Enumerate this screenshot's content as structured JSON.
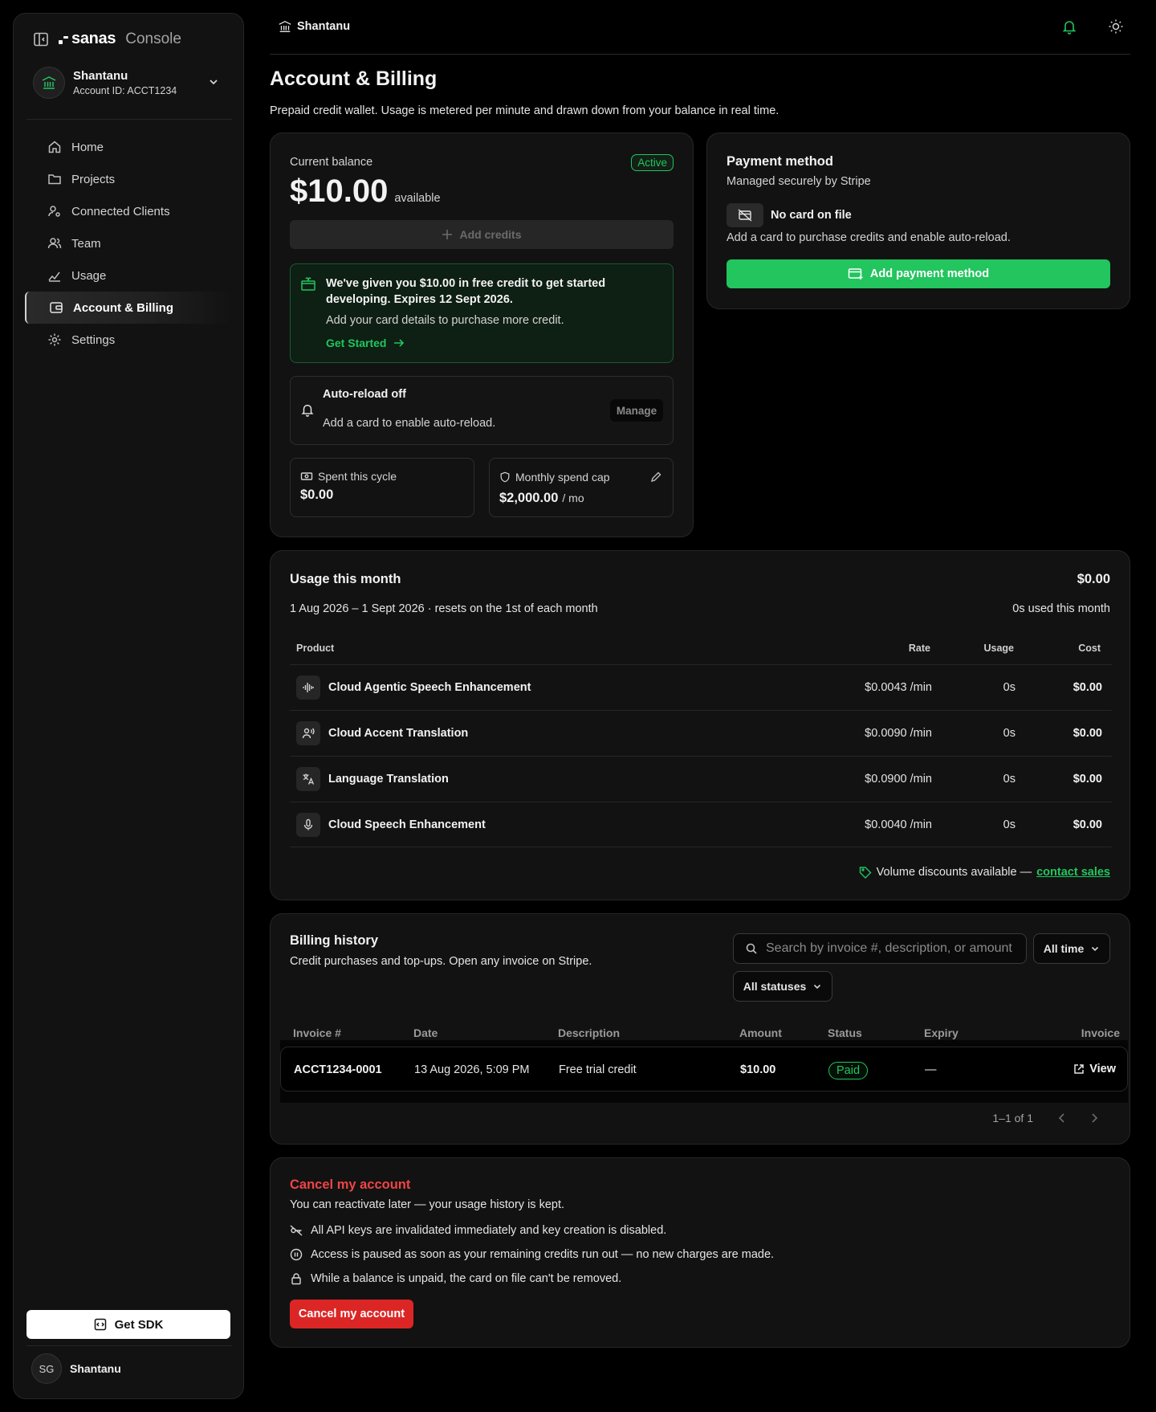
{
  "sidebar": {
    "brand": "sanas",
    "brand_suffix": "Console",
    "account_name": "Shantanu",
    "account_id": "Account ID: ACCT1234",
    "nav": [
      "Home",
      "Projects",
      "Connected Clients",
      "Team",
      "Usage",
      "Account & Billing",
      "Settings"
    ],
    "active_item": "Account & Billing",
    "sdk_label": "Get SDK",
    "user_initials": "SG",
    "user_name": "Shantanu"
  },
  "topbar": {
    "breadcrumb": "Shantanu"
  },
  "page": {
    "title": "Account & Billing",
    "subtitle": "Prepaid credit wallet. Usage is metered per minute and drawn down from your balance in real time."
  },
  "balance": {
    "label": "Current balance",
    "status": "Active",
    "amount": "$10.00",
    "amount_suffix": "available",
    "add_credits": "Add credits",
    "promo_line1": "We've given you $10.00 in free credit to get started",
    "promo_line2": "developing. Expires 12 Sept 2026.",
    "promo_body": "Add your card details to purchase more credit.",
    "promo_link": "Get Started",
    "autoreload_title": "Auto-reload off",
    "autoreload_body": "Add a card to enable auto-reload.",
    "manage": "Manage",
    "spent_label": "Spent this cycle",
    "spent_value": "$0.00",
    "cap_label": "Monthly spend cap",
    "cap_value": "$2,000.00",
    "cap_unit": "/ mo"
  },
  "payment": {
    "title": "Payment method",
    "subtitle": "Managed securely by Stripe",
    "no_card": "No card on file",
    "body": "Add a card to purchase credits and enable auto-reload.",
    "button": "Add payment method"
  },
  "usage": {
    "title": "Usage this month",
    "total": "$0.00",
    "period": "1 Aug 2026 – 1 Sept 2026 · resets on the 1st of each month",
    "used": "0s used this month",
    "columns": {
      "product": "Product",
      "rate": "Rate",
      "usage": "Usage",
      "cost": "Cost"
    },
    "rows": [
      {
        "product": "Cloud Agentic Speech Enhancement",
        "icon": "waveform-icon",
        "rate": "$0.0043 /min",
        "usage": "0s",
        "cost": "$0.00"
      },
      {
        "product": "Cloud Accent Translation",
        "icon": "speaker-person-icon",
        "rate": "$0.0090 /min",
        "usage": "0s",
        "cost": "$0.00"
      },
      {
        "product": "Language Translation",
        "icon": "translate-icon",
        "rate": "$0.0900 /min",
        "usage": "0s",
        "cost": "$0.00"
      },
      {
        "product": "Cloud Speech Enhancement",
        "icon": "microphone-icon",
        "rate": "$0.0040 /min",
        "usage": "0s",
        "cost": "$0.00"
      }
    ],
    "discount_text": "Volume discounts available —",
    "discount_link": "contact sales"
  },
  "billing": {
    "title": "Billing history",
    "subtitle": "Credit purchases and top-ups. Open any invoice on Stripe.",
    "search_placeholder": "Search by invoice #, description, or amount",
    "time_filter": "All time",
    "status_filter": "All statuses",
    "columns": {
      "invoice": "Invoice #",
      "date": "Date",
      "description": "Description",
      "amount": "Amount",
      "status": "Status",
      "expiry": "Expiry",
      "link": "Invoice"
    },
    "rows": [
      {
        "invoice": "ACCT1234-0001",
        "date": "13 Aug 2026, 5:09 PM",
        "description": "Free trial credit",
        "amount": "$10.00",
        "status": "Paid",
        "expiry": "—",
        "link": "View"
      }
    ],
    "pagination": "1–1 of 1"
  },
  "cancel": {
    "title": "Cancel my account",
    "subtitle": "You can reactivate later — your usage history is kept.",
    "bullets": [
      "All API keys are invalidated immediately and key creation is disabled.",
      "Access is paused as soon as your remaining credits run out — no new charges are made.",
      "While a balance is unpaid, the card on file can't be removed."
    ],
    "button": "Cancel my account"
  },
  "colors": {
    "accent_green": "#22c55e",
    "danger_red": "#dc2626",
    "background": "#000000",
    "card": "#121212"
  }
}
